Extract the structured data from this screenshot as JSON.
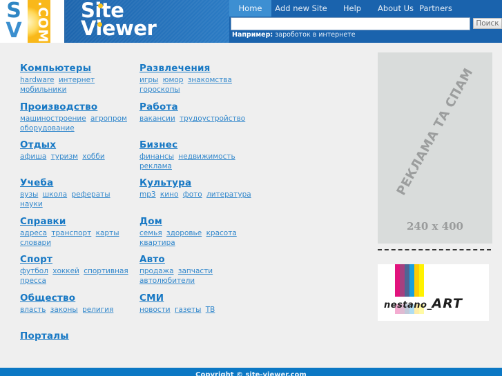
{
  "logo": {
    "sv_top": "S",
    "sv_bottom": "V",
    "com": ".COM",
    "brand_line1": "Site",
    "brand_line2": "Viewer"
  },
  "nav": {
    "items": [
      {
        "label": "Home",
        "active": true
      },
      {
        "label": "Add new Site",
        "active": false
      },
      {
        "label": "Help",
        "active": false
      },
      {
        "label": "About Us",
        "active": false
      },
      {
        "label": "Partners",
        "active": false
      }
    ]
  },
  "search": {
    "value": "",
    "placeholder": "",
    "button_label": "Поиск",
    "example_label": "Например:",
    "example_query": "зароботок в интернете"
  },
  "categories": [
    {
      "title": "Компьютеры",
      "links": [
        "hardware",
        "интернет",
        "мобильники"
      ]
    },
    {
      "title": "Развлечения",
      "links": [
        "игры",
        "юмор",
        "знакомства",
        "гороскопы"
      ]
    },
    {
      "title": "Производство",
      "links": [
        "машиностроение",
        "агропром",
        "оборудование"
      ]
    },
    {
      "title": "Работа",
      "links": [
        "вакансии",
        "трудоустройство"
      ]
    },
    {
      "title": "Отдых",
      "links": [
        "афиша",
        "туризм",
        "хобби"
      ]
    },
    {
      "title": "Бизнес",
      "links": [
        "финансы",
        "недвижимость",
        "реклама"
      ]
    },
    {
      "title": "Учеба",
      "links": [
        "вузы",
        "школа",
        "рефераты",
        "науки"
      ]
    },
    {
      "title": "Культура",
      "links": [
        "mp3",
        "кино",
        "фото",
        "литература"
      ]
    },
    {
      "title": "Справки",
      "links": [
        "адреса",
        "транспорт",
        "карты",
        "словари"
      ]
    },
    {
      "title": "Дом",
      "links": [
        "семья",
        "здоровье",
        "красота",
        "квартира"
      ]
    },
    {
      "title": "Спорт",
      "links": [
        "футбол",
        "хоккей",
        "спортивная",
        "пресса"
      ]
    },
    {
      "title": "Авто",
      "links": [
        "продажа",
        "запчасти",
        "автолюбители"
      ]
    },
    {
      "title": "Общество",
      "links": [
        "власть",
        "законы",
        "религия"
      ]
    },
    {
      "title": "СМИ",
      "links": [
        "новости",
        "газеты",
        "ТВ"
      ]
    },
    {
      "title": "Порталы",
      "links": []
    }
  ],
  "ad": {
    "text": "РЕКЛАМА ТА СПАМ",
    "size": "240 x 400"
  },
  "banner": {
    "brand": "nestano_",
    "brand_art": "ART",
    "colors": [
      "#e2137d",
      "#a5407f",
      "#4d6694",
      "#1aa0de",
      "#ffcb05",
      "#fff200"
    ]
  },
  "footer": {
    "text": "Copyright © site-viewer.com"
  },
  "colors": {
    "header_blue": "#1a63ad",
    "nav_active": "#3d8fd2",
    "link_blue": "#1778c4",
    "footer_blue": "#0c78c4",
    "page_bg": "#efefef"
  }
}
